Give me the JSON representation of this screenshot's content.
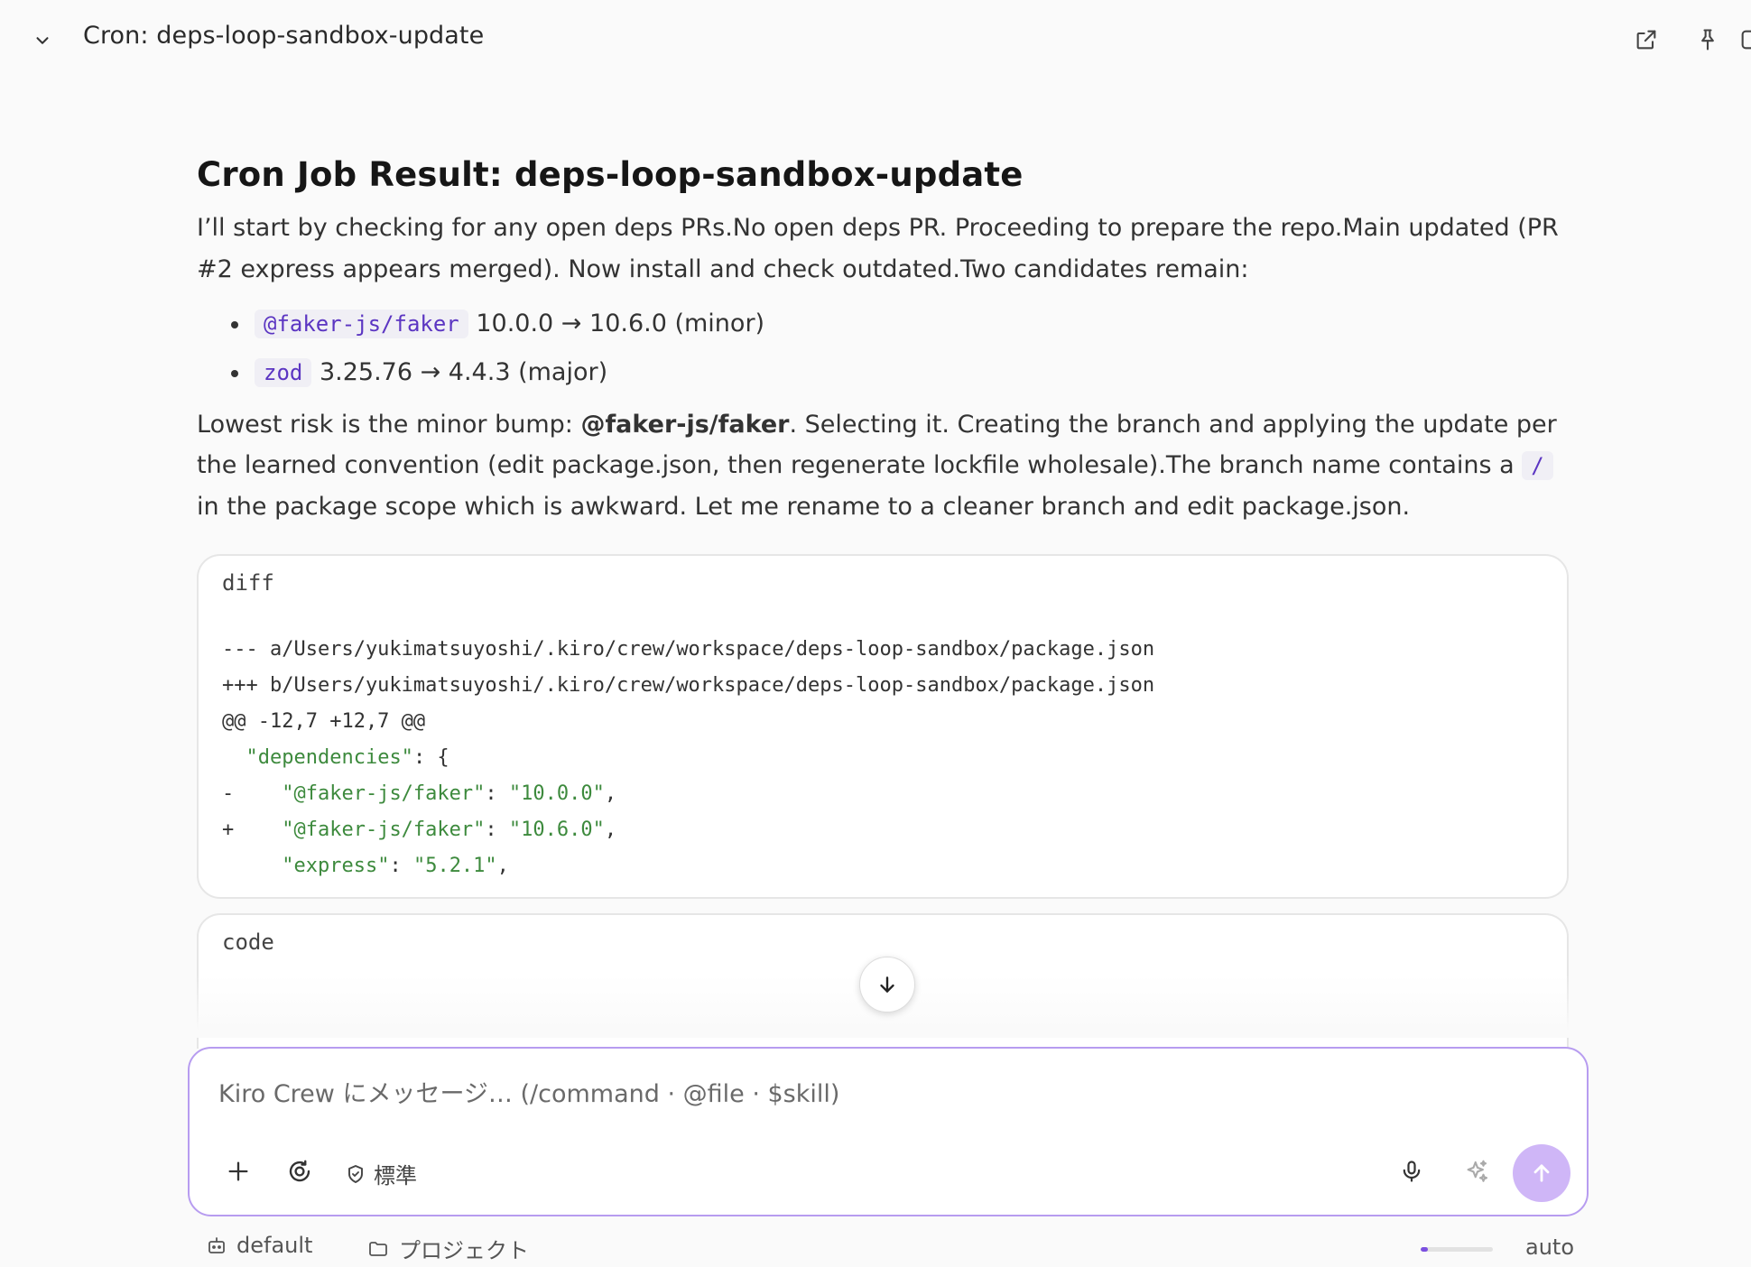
{
  "header": {
    "title": "Cron: deps-loop-sandbox-update"
  },
  "main": {
    "title": "Cron Job Result: deps-loop-sandbox-update",
    "intro": "I’ll start by checking for any open deps PRs.No open deps PR. Proceeding to prepare the repo.Main updated (PR #2 express appears merged). Now install and check outdated.Two candidates remain:",
    "candidates": [
      {
        "pkg": "@faker-js/faker",
        "detail": "10.0.0 → 10.6.0 (minor)"
      },
      {
        "pkg": "zod",
        "detail": "3.25.76 → 4.4.3 (major)"
      }
    ],
    "para2_a": "Lowest risk is the minor bump: ",
    "para2_bold": "@faker-js/faker",
    "para2_b": ". Selecting it. Creating the branch and applying the update per the learned convention (edit package.json, then regenerate lockfile wholesale).The branch name contains a ",
    "para2_code": "/",
    "para2_c": " in the package scope which is awkward. Let me rename to a cleaner branch and edit package.json."
  },
  "diff_block": {
    "lang": "diff",
    "line1": "--- a/Users/yukimatsuyoshi/.kiro/crew/workspace/deps-loop-sandbox/package.json",
    "line2": "+++ b/Users/yukimatsuyoshi/.kiro/crew/workspace/deps-loop-sandbox/package.json",
    "line3": "@@ -12,7 +12,7 @@",
    "l4_key": "\"dependencies\"",
    "l4_rest": ": {",
    "l5_prefix": "-",
    "l5_key": "\"@faker-js/faker\"",
    "l5_val": "\"10.0.0\"",
    "l6_prefix": "+",
    "l6_key": "\"@faker-js/faker\"",
    "l6_val": "\"10.6.0\"",
    "l7_key": "\"express\"",
    "l7_val": "\"5.2.1\""
  },
  "code_block": {
    "lang": "code"
  },
  "composer": {
    "placeholder": "Kiro Crew にメッセージ… (/command · @file · $skill)",
    "mode_label": "標準"
  },
  "footer": {
    "agent": "default",
    "project": "プロジェクト",
    "model": "auto",
    "context_usage_fraction": 0.1
  },
  "colors": {
    "accent": "#b79cf0",
    "send": "#cfb6f7",
    "inline_code": "#5b35c2",
    "diff_string": "#3d8a3d"
  }
}
